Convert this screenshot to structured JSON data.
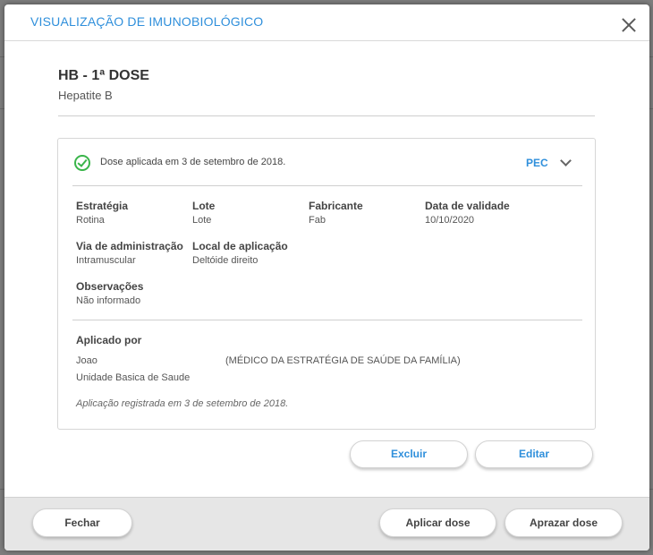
{
  "modal": {
    "title": "VISUALIZAÇÃO DE IMUNOBIOLÓGICO"
  },
  "vaccine": {
    "title": "HB - 1ª DOSE",
    "subtitle": "Hepatite B"
  },
  "card": {
    "status": "Dose aplicada em 3 de setembro de 2018.",
    "source": "PEC",
    "fields": [
      {
        "label": "Estratégia",
        "value": "Rotina"
      },
      {
        "label": "Lote",
        "value": "Lote"
      },
      {
        "label": "Fabricante",
        "value": "Fab"
      },
      {
        "label": "Data de validade",
        "value": "10/10/2020"
      },
      {
        "label": "Via de administração",
        "value": "Intramuscular"
      },
      {
        "label": "Local de aplicação",
        "value": "Deltóide direito"
      },
      {
        "label": "Observações",
        "value": "Não informado"
      }
    ],
    "applied_by": {
      "label": "Aplicado por",
      "name": "Joao",
      "role": "(MÉDICO DA ESTRATÉGIA DE SAÚDE DA FAMÍLIA)",
      "unit": "Unidade Basica de Saude"
    },
    "registered": "Aplicação registrada em 3 de setembro de 2018."
  },
  "actions": {
    "delete": "Excluir",
    "edit": "Editar"
  },
  "footer": {
    "close": "Fechar",
    "apply": "Aplicar dose",
    "postpone": "Aprazar dose"
  },
  "colors": {
    "accent": "#2f8fdb",
    "success": "#3ab54a",
    "overlay": "#7d7d7d"
  },
  "icons": {
    "close": "close-icon",
    "status": "check-circle-icon",
    "expand": "chevron-down-icon"
  }
}
